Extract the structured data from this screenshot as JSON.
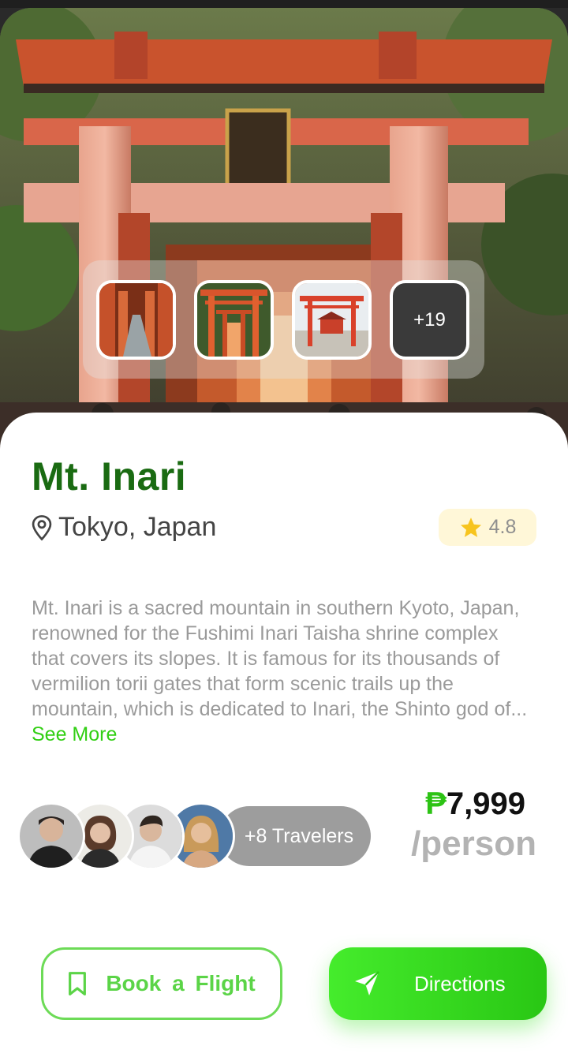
{
  "gallery": {
    "more_label": "+19",
    "thumbnails": [
      "torii-tunnel",
      "torii-gates-row",
      "shrine-gate"
    ]
  },
  "place": {
    "name": "Mt. Inari",
    "location": "Tokyo, Japan",
    "rating": "4.8",
    "description": "Mt. Inari is a sacred mountain in southern Kyoto, Japan, renowned for the Fushimi Inari Taisha shrine complex that covers its slopes.  It is famous for its thousands of vermilion torii gates that form scenic trails up the mountain, which is dedicated to Inari, the Shinto god of...",
    "see_more_label": "See More"
  },
  "travelers": {
    "more_label": "+8 Travelers",
    "avatars": [
      "traveler-1",
      "traveler-2",
      "traveler-3",
      "traveler-4"
    ]
  },
  "pricing": {
    "currency": "₱",
    "amount": "7,999",
    "unit": "/person"
  },
  "actions": {
    "book_label": "Book a  Flight",
    "directions_label": "Directions"
  },
  "colors": {
    "title_green": "#1a6b12",
    "accent_green": "#32cf14",
    "rating_bg": "#fff7d8",
    "star": "#f7c41e",
    "torii_vermilion": "#d9552c"
  },
  "icons": [
    "location-pin-icon",
    "star-icon",
    "bookmark-icon",
    "navigation-arrow-icon"
  ]
}
